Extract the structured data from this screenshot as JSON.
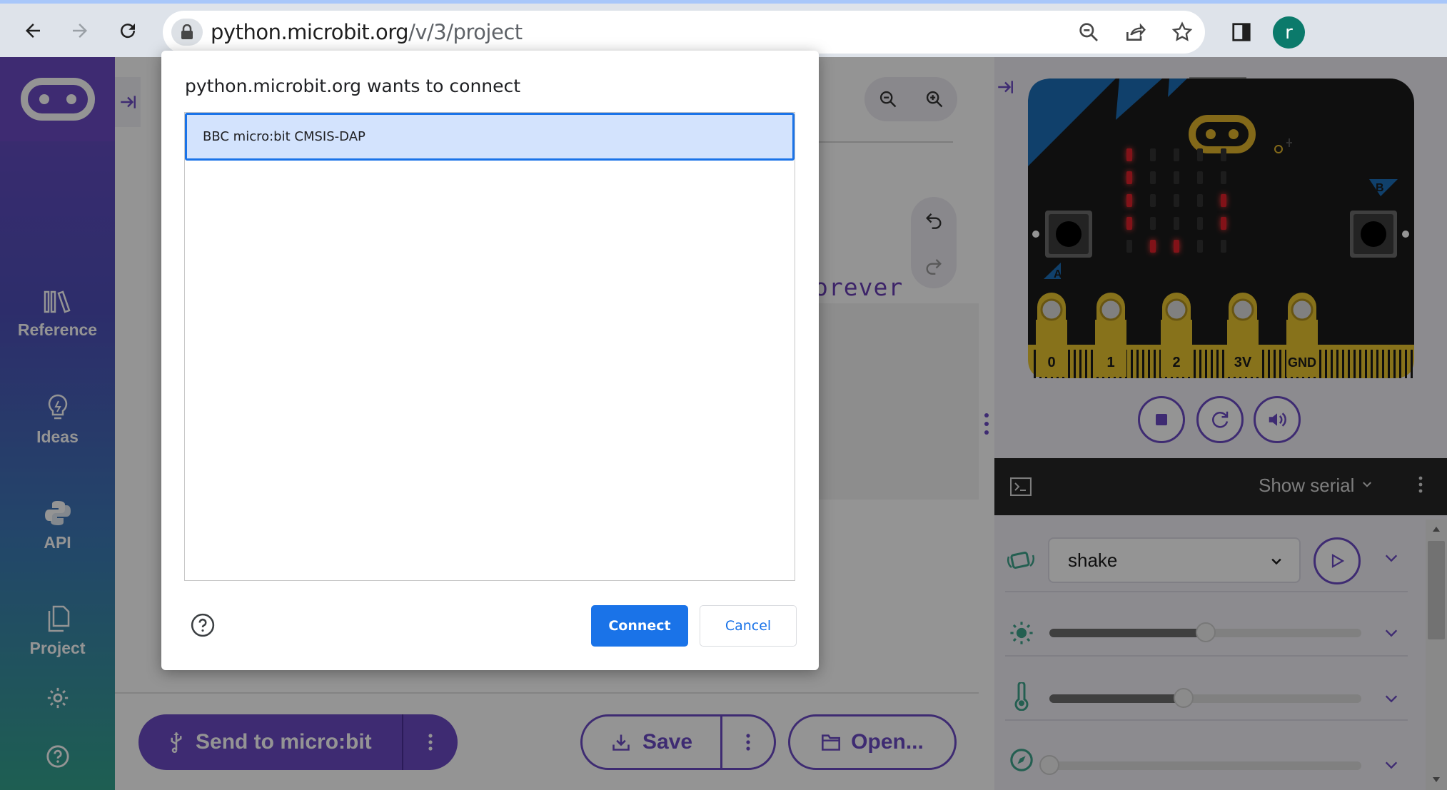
{
  "browser": {
    "url_domain": "python.microbit.org",
    "url_path": "/v/3/project",
    "profile_initial": "r"
  },
  "sidebar": {
    "items": [
      {
        "label": "Reference",
        "icon": "library-icon"
      },
      {
        "label": "Ideas",
        "icon": "lightbulb-icon"
      },
      {
        "label": "API",
        "icon": "python-icon"
      },
      {
        "label": "Project",
        "icon": "files-icon"
      }
    ]
  },
  "editor": {
    "code_fragment": "orever"
  },
  "toolbar": {
    "send_label": "Send to micro:bit",
    "save_label": "Save",
    "open_label": "Open..."
  },
  "simulator": {
    "pins": [
      "0",
      "1",
      "2",
      "3V",
      "GND"
    ],
    "button_a": "A",
    "button_b": "B",
    "serial_label": "Show serial",
    "gesture_value": "shake",
    "light_level": 0.5,
    "temperature_level": 0.43,
    "compass_level": 0.0
  },
  "dialog": {
    "title": "python.microbit.org wants to connect",
    "device": "BBC micro:bit CMSIS-DAP",
    "connect_label": "Connect",
    "cancel_label": "Cancel"
  },
  "colors": {
    "brand": "#6c4bc4",
    "dialog_accent": "#1a73e8",
    "led_on": "#e0202a"
  }
}
